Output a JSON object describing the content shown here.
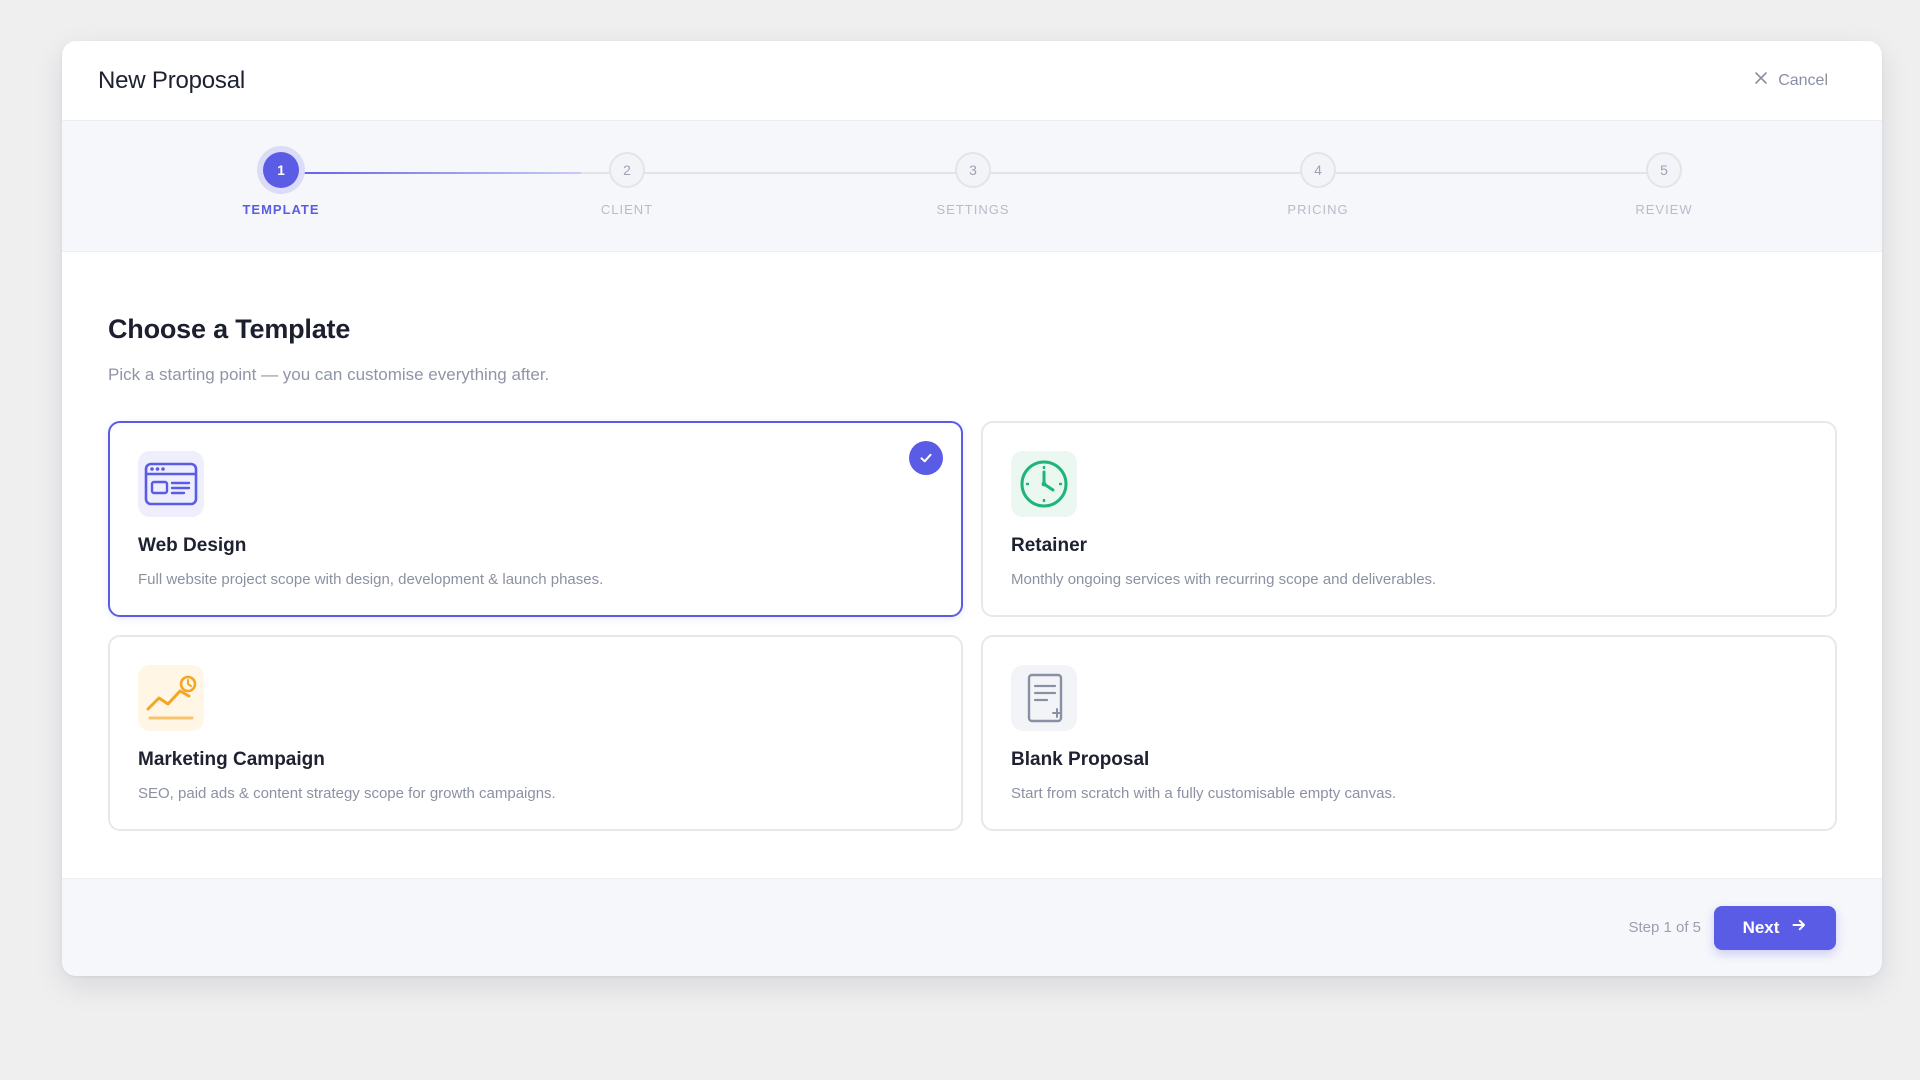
{
  "header": {
    "title": "New Proposal",
    "cancel_label": "Cancel"
  },
  "stepper": {
    "steps": [
      {
        "number": "1",
        "label": "TEMPLATE",
        "state": "active"
      },
      {
        "number": "2",
        "label": "CLIENT",
        "state": "inactive"
      },
      {
        "number": "3",
        "label": "SETTINGS",
        "state": "inactive"
      },
      {
        "number": "4",
        "label": "PRICING",
        "state": "inactive"
      },
      {
        "number": "5",
        "label": "REVIEW",
        "state": "inactive"
      }
    ]
  },
  "main": {
    "title": "Choose a Template",
    "subtitle": "Pick a starting point — you can customise everything after.",
    "templates": [
      {
        "title": "Web Design",
        "description": "Full website project scope with design, development & launch phases.",
        "icon": "browser-layout-icon",
        "selected": true
      },
      {
        "title": "Retainer",
        "description": "Monthly ongoing services with recurring scope and deliverables.",
        "icon": "clock-icon",
        "selected": false
      },
      {
        "title": "Marketing Campaign",
        "description": "SEO, paid ads & content strategy scope for growth campaigns.",
        "icon": "growth-chart-icon",
        "selected": false
      },
      {
        "title": "Blank Proposal",
        "description": "Start from scratch with a fully customisable empty canvas.",
        "icon": "blank-document-icon",
        "selected": false
      }
    ]
  },
  "footer": {
    "step_count": "Step 1 of 5",
    "next_label": "Next"
  },
  "colors": {
    "accent": "#5b5ce6",
    "retainer_icon": "#1fb57a",
    "marketing_icon": "#f5a524",
    "blank_icon": "#8a90a3"
  }
}
